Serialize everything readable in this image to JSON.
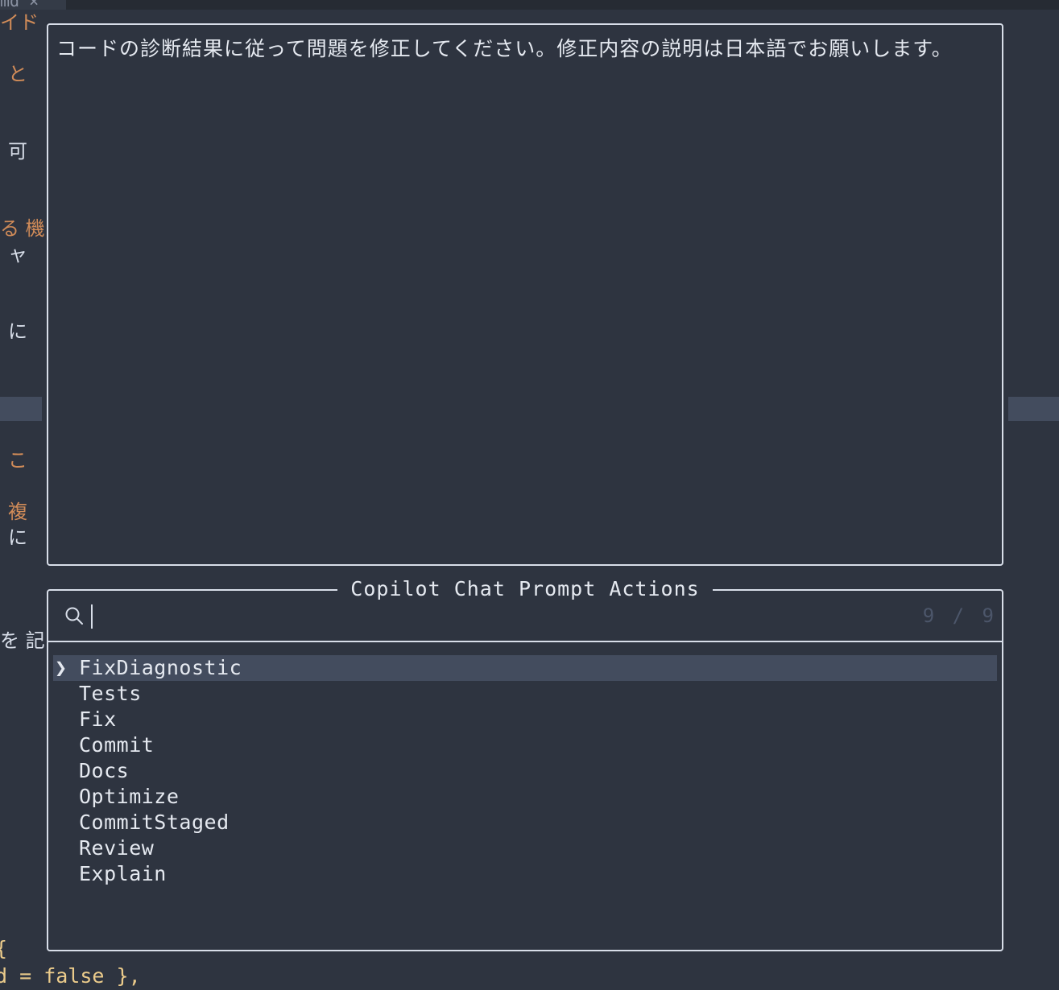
{
  "tabline": {
    "tab_label": "md",
    "close_glyph": "×"
  },
  "background": {
    "fragments": [
      {
        "text": "イド",
        "color": "orange"
      },
      {
        "text": "と",
        "color": "orange"
      },
      {
        "text": "可",
        "color": "plain"
      },
      {
        "text": "る 機",
        "color": "orange"
      },
      {
        "text": "ャ",
        "color": "plain"
      },
      {
        "text": "に",
        "color": "plain"
      },
      {
        "text": "こ",
        "color": "orange"
      },
      {
        "text": "複",
        "color": "orange"
      },
      {
        "text": "に",
        "color": "plain"
      },
      {
        "text": "を 記",
        "color": "plain"
      }
    ],
    "code_lines": [
      "{",
      "d = false },"
    ]
  },
  "preview": {
    "text": "コードの診断結果に従って問題を修正してください。修正内容の説明は日本語でお願いします。"
  },
  "picker": {
    "title": "Copilot Chat Prompt Actions",
    "search_value": "",
    "search_icon": "search-icon",
    "counter": "9 / 9",
    "caret": "❯",
    "items": [
      {
        "label": "FixDiagnostic",
        "selected": true
      },
      {
        "label": "Tests",
        "selected": false
      },
      {
        "label": "Fix",
        "selected": false
      },
      {
        "label": "Commit",
        "selected": false
      },
      {
        "label": "Docs",
        "selected": false
      },
      {
        "label": "Optimize",
        "selected": false
      },
      {
        "label": "CommitStaged",
        "selected": false
      },
      {
        "label": "Review",
        "selected": false
      },
      {
        "label": "Explain",
        "selected": false
      }
    ]
  },
  "colors": {
    "background": "#2e3440",
    "border": "#d8dee9",
    "selection": "#434c5e",
    "accent_orange": "#d08b58",
    "dim": "#4c566a"
  }
}
